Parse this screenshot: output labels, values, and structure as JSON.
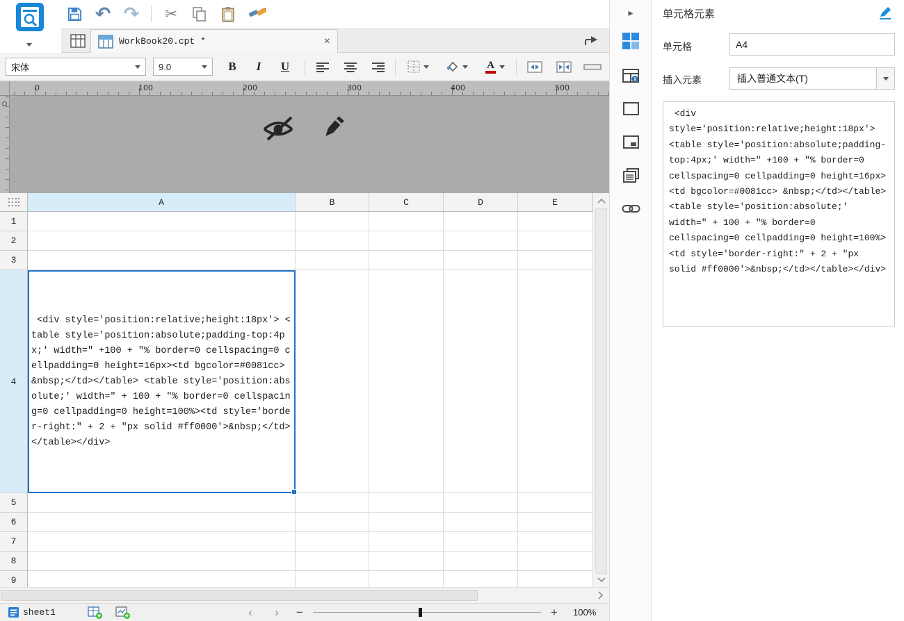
{
  "code": " <div style='position:relative;height:18px'> <table style='position:absolute;padding-top:4px;' width=\" +100 + \"% border=0 cellspacing=0 cellpadding=0 height=16px><td bgcolor=#0081cc> &nbsp;</td></table> <table style='position:absolute;' width=\" + 100 + \"% border=0 cellspacing=0 cellpadding=0 height=100%><td style='border-right:\" + 2 + \"px solid #ff0000'>&nbsp;</td></table></div>",
  "tabbar": {
    "title": "WorkBook20.cpt *"
  },
  "format": {
    "font_family": "宋体",
    "font_size": "9.0",
    "bold": "B",
    "italic": "I",
    "underline": "U",
    "font_color_letter": "A"
  },
  "ruler": {
    "ticks": [
      "0",
      "100",
      "200",
      "300",
      "400",
      "500"
    ]
  },
  "sheet": {
    "columns": [
      "A",
      "B",
      "C",
      "D",
      "E"
    ],
    "rows": [
      "1",
      "2",
      "3",
      "4",
      "5",
      "6",
      "7",
      "8",
      "9"
    ],
    "active_cell": "A4"
  },
  "panel": {
    "title": "单元格元素",
    "cell_label": "单元格",
    "cell_value": "A4",
    "insert_label": "插入元素",
    "insert_selected": "插入普通文本(T)"
  },
  "statusbar": {
    "sheet_name": "sheet1",
    "zoom": "100%"
  },
  "icons": {
    "undo": "↶",
    "redo": "↷",
    "cut": "✂",
    "close": "×",
    "collapse_arrow": "▸",
    "chevron_left": "‹",
    "chevron_right": "›",
    "minus": "−",
    "plus": "+"
  },
  "colors": {
    "accent": "#0081cc",
    "selection": "#2171c7",
    "header_selected": "#d6ecf9",
    "cell_bar_red": "#ff0000"
  }
}
